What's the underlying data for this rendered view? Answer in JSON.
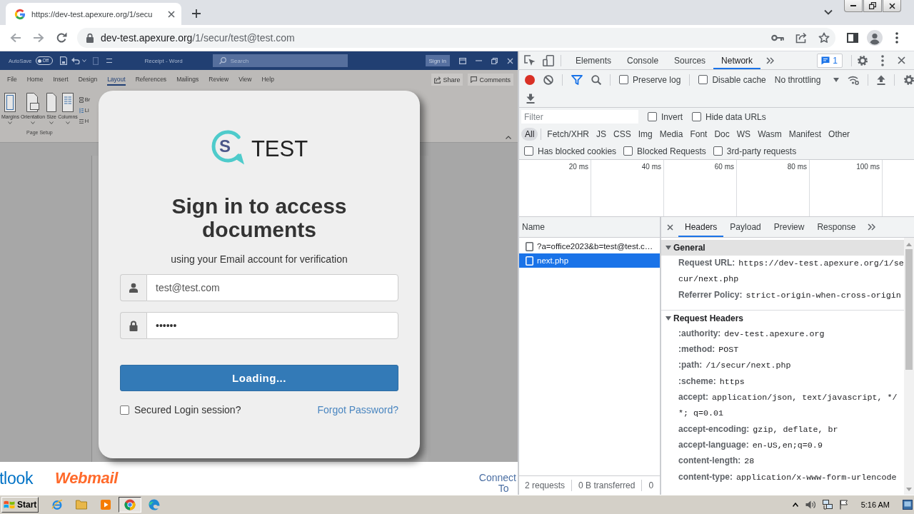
{
  "browser": {
    "tabs": [
      {
        "title": "https://dev-test.apexure.org/1/secu",
        "selected": true
      }
    ],
    "address": {
      "host": "dev-test.apexure.org",
      "path": "/1/secur/test@test.com"
    }
  },
  "page": {
    "background_app": {
      "autosave": "AutoSave",
      "autosave_toggle": "Off",
      "document_title": "Receipt - Word",
      "search_placeholder": "Search",
      "sign_in": "Sign in",
      "tabs": [
        {
          "label": "File",
          "selected": false
        },
        {
          "label": "Home",
          "selected": false
        },
        {
          "label": "Insert",
          "selected": false
        },
        {
          "label": "Design",
          "selected": false
        },
        {
          "label": "Layout",
          "selected": true
        },
        {
          "label": "References",
          "selected": false
        },
        {
          "label": "Mailings",
          "selected": false
        },
        {
          "label": "Review",
          "selected": false
        },
        {
          "label": "View",
          "selected": false
        },
        {
          "label": "Help",
          "selected": false
        }
      ],
      "share": "Share",
      "comments": "Comments",
      "ribbon_buttons": [
        "Margins",
        "Orientation",
        "Size",
        "Columns"
      ],
      "ribbon_small_buttons": [
        "Br",
        "Li",
        "H"
      ],
      "group_label": "Page Setup"
    },
    "login": {
      "logo_mark": "S",
      "logo_text": "TEST",
      "heading": "Sign in to access documents",
      "subtitle": "using your Email account for verification",
      "fields": [
        {
          "kind": "email",
          "value": "test@test.com"
        },
        {
          "kind": "password",
          "value": "••••••"
        }
      ],
      "submit": "Loading...",
      "remember": {
        "label": "Secured Login session?",
        "checked": false
      },
      "forgot_link": "Forgot Password?"
    },
    "footer": {
      "outlook_logo": "tlook",
      "webmail_logo": "Webmail",
      "link_lines": [
        "Connect",
        "To"
      ]
    }
  },
  "devtools": {
    "panel_tabs": [
      {
        "label": "Elements",
        "selected": false
      },
      {
        "label": "Console",
        "selected": false
      },
      {
        "label": "Sources",
        "selected": false
      },
      {
        "label": "Network",
        "selected": true
      }
    ],
    "issues_count": "1",
    "recording": true,
    "filter_active": true,
    "preserve_log": {
      "label": "Preserve log",
      "checked": false
    },
    "disable_cache": {
      "label": "Disable cache",
      "checked": false
    },
    "throttling": "No throttling",
    "filter": {
      "placeholder": "Filter",
      "invert": {
        "label": "Invert",
        "checked": false
      },
      "hide_data_urls": {
        "label": "Hide data URLs",
        "checked": false
      }
    },
    "resource_types": [
      {
        "label": "All",
        "selected": true
      },
      {
        "label": "Fetch/XHR",
        "selected": false
      },
      {
        "label": "JS",
        "selected": false
      },
      {
        "label": "CSS",
        "selected": false
      },
      {
        "label": "Img",
        "selected": false
      },
      {
        "label": "Media",
        "selected": false
      },
      {
        "label": "Font",
        "selected": false
      },
      {
        "label": "Doc",
        "selected": false
      },
      {
        "label": "WS",
        "selected": false
      },
      {
        "label": "Wasm",
        "selected": false
      },
      {
        "label": "Manifest",
        "selected": false
      },
      {
        "label": "Other",
        "selected": false
      }
    ],
    "request_filters": [
      {
        "label": "Has blocked cookies",
        "checked": false
      },
      {
        "label": "Blocked Requests",
        "checked": false
      },
      {
        "label": "3rd-party requests",
        "checked": false
      }
    ],
    "overview_ticks": [
      "20 ms",
      "40 ms",
      "60 ms",
      "80 ms",
      "100 ms"
    ],
    "requests": {
      "column": "Name",
      "rows": [
        {
          "name": "?a=office2023&b=test@test.c…",
          "selected": false
        },
        {
          "name": "next.php",
          "selected": true
        }
      ],
      "summary": [
        "2 requests",
        "0 B transferred",
        "0"
      ]
    },
    "details": {
      "tabs": [
        {
          "label": "Headers",
          "selected": true
        },
        {
          "label": "Payload",
          "selected": false
        },
        {
          "label": "Preview",
          "selected": false
        },
        {
          "label": "Response",
          "selected": false
        }
      ],
      "sections": [
        {
          "title": "General",
          "expanded": true,
          "highlighted": true,
          "rows": [
            {
              "name": "Request URL:",
              "value": "https://dev-test.apexure.org/1/secur/next.php"
            },
            {
              "name": "Referrer Policy:",
              "value": "strict-origin-when-cross-origin"
            }
          ]
        },
        {
          "title": "Request Headers",
          "expanded": true,
          "highlighted": false,
          "rows": [
            {
              "name": ":authority:",
              "value": "dev-test.apexure.org"
            },
            {
              "name": ":method:",
              "value": "POST"
            },
            {
              "name": ":path:",
              "value": "/1/secur/next.php"
            },
            {
              "name": ":scheme:",
              "value": "https"
            },
            {
              "name": "accept:",
              "value": "application/json, text/javascript, */*; q=0.01"
            },
            {
              "name": "accept-encoding:",
              "value": "gzip, deflate, br"
            },
            {
              "name": "accept-language:",
              "value": "en-US,en;q=0.9"
            },
            {
              "name": "content-length:",
              "value": "28"
            },
            {
              "name": "content-type:",
              "value": "application/x-www-form-urlencode"
            }
          ]
        }
      ]
    }
  },
  "taskbar": {
    "start": "Start",
    "apps": [
      {
        "selected": false
      },
      {
        "selected": false
      },
      {
        "selected": false
      },
      {
        "selected": true
      },
      {
        "selected": false
      }
    ],
    "clock": "5:16 AM"
  }
}
